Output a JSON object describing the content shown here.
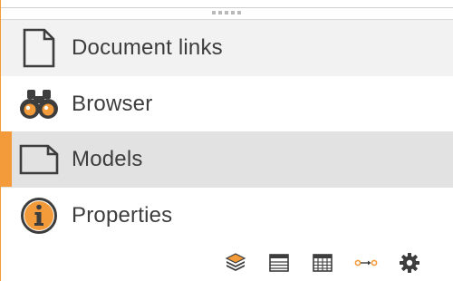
{
  "nav": {
    "items": [
      {
        "label": "Document links",
        "icon": "document-icon"
      },
      {
        "label": "Browser",
        "icon": "binoculars-icon"
      },
      {
        "label": "Models",
        "icon": "model-document-icon",
        "active": true
      },
      {
        "label": "Properties",
        "icon": "info-icon"
      }
    ]
  },
  "toolbar": {
    "icons": [
      "layers-icon",
      "list-view-icon",
      "grid-view-icon",
      "link-flow-icon",
      "gear-icon"
    ]
  },
  "colors": {
    "accent": "#f39a3a",
    "text": "#3d3d3d",
    "selected_bg": "#e2e2e2",
    "hover_bg": "#f2f2f2"
  }
}
